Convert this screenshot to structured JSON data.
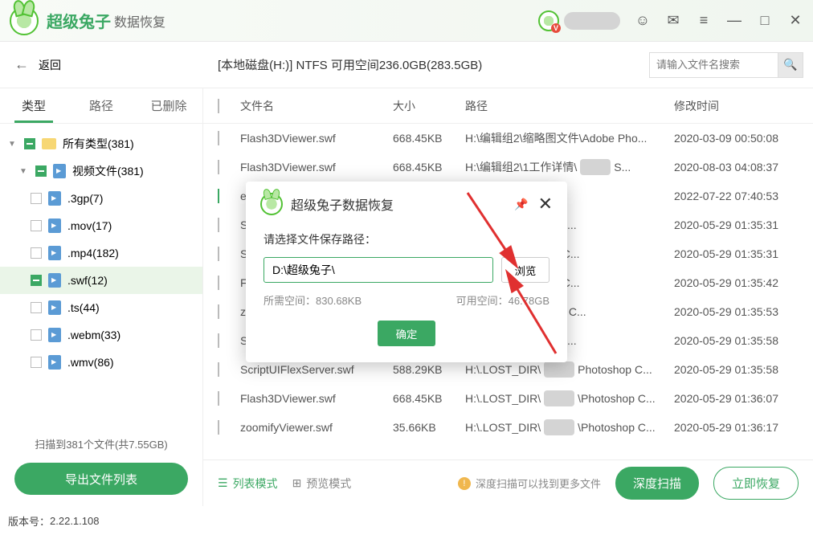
{
  "app": {
    "title_main": "超级兔子",
    "title_sub": "数据恢复"
  },
  "subheader": {
    "back_label": "返回",
    "disk_info": "[本地磁盘(H:)] NTFS 可用空间236.0GB(283.5GB)",
    "search_placeholder": "请输入文件名搜索"
  },
  "tabs": {
    "type": "类型",
    "path": "路径",
    "deleted": "已删除"
  },
  "tree": {
    "all": "所有类型(381)",
    "video": "视频文件(381)",
    "ext_3gp": ".3gp(7)",
    "ext_mov": ".mov(17)",
    "ext_mp4": ".mp4(182)",
    "ext_swf": ".swf(12)",
    "ext_ts": ".ts(44)",
    "ext_webm": ".webm(33)",
    "ext_wmv": ".wmv(86)"
  },
  "sidebar_footer": {
    "summary": "扫描到381个文件(共7.55GB)",
    "export_btn": "导出文件列表"
  },
  "columns": {
    "filename": "文件名",
    "size": "大小",
    "path": "路径",
    "mtime": "修改时间"
  },
  "rows": [
    {
      "name": "Flash3DViewer.swf",
      "size": "668.45KB",
      "path_pre": "H:\\编辑组2\\缩略图文件\\Adobe Pho...",
      "path_suf": "",
      "time": "2020-03-09 00:50:08",
      "checked": false,
      "mask": 0
    },
    {
      "name": "Flash3DViewer.swf",
      "size": "668.45KB",
      "path_pre": "H:\\编辑组2\\1工作详情\\",
      "path_suf": "S...",
      "time": "2020-08-03 04:08:37",
      "checked": false,
      "mask": 1
    },
    {
      "name": "e",
      "size": "",
      "path_pre": "",
      "path_suf": "",
      "time": "2022-07-22 07:40:53",
      "checked": true,
      "mask": 0
    },
    {
      "name": "S",
      "size": "",
      "path_pre": "",
      "path_suf": "Photoshop C...",
      "time": "2020-05-29 01:35:31",
      "checked": false,
      "mask": 1
    },
    {
      "name": "S",
      "size": "",
      "path_pre": "",
      "path_suf": "\\Photoshop C...",
      "time": "2020-05-29 01:35:31",
      "checked": false,
      "mask": 1
    },
    {
      "name": "F",
      "size": "",
      "path_pre": "",
      "path_suf": "\\Photoshop C...",
      "time": "2020-05-29 01:35:42",
      "checked": false,
      "mask": 1
    },
    {
      "name": "z",
      "size": "",
      "path_pre": "",
      "path_suf": "Photoshop C...",
      "time": "2020-05-29 01:35:53",
      "checked": false,
      "mask": 2
    },
    {
      "name": "S",
      "size": "",
      "path_pre": "",
      "path_suf": "Photoshop C...",
      "time": "2020-05-29 01:35:58",
      "checked": false,
      "mask": 1
    },
    {
      "name": "ScriptUIFlexServer.swf",
      "size": "588.29KB",
      "path_pre": "H:\\.LOST_DIR\\",
      "path_suf": "Photoshop C...",
      "time": "2020-05-29 01:35:58",
      "checked": false,
      "mask": 1
    },
    {
      "name": "Flash3DViewer.swf",
      "size": "668.45KB",
      "path_pre": "H:\\.LOST_DIR\\",
      "path_suf": "\\Photoshop C...",
      "time": "2020-05-29 01:36:07",
      "checked": false,
      "mask": 1
    },
    {
      "name": "zoomifyViewer.swf",
      "size": "35.66KB",
      "path_pre": "H:\\.LOST_DIR\\",
      "path_suf": "\\Photoshop C...",
      "time": "2020-05-29 01:36:17",
      "checked": false,
      "mask": 1
    }
  ],
  "bottom": {
    "list_mode": "列表模式",
    "preview_mode": "预览模式",
    "hint": "深度扫描可以找到更多文件",
    "deep_scan": "深度扫描",
    "recover": "立即恢复"
  },
  "status": {
    "version_label": "版本号：",
    "version_value": "2.22.1.108"
  },
  "modal": {
    "title": "超级兔子数据恢复",
    "label": "请选择文件保存路径：",
    "path_value": "D:\\超级兔子\\",
    "browse": "浏览",
    "need_label": "所需空间：",
    "need_value": "830.68KB",
    "avail_label": "可用空间：",
    "avail_value": "46.78GB",
    "confirm": "确定"
  }
}
